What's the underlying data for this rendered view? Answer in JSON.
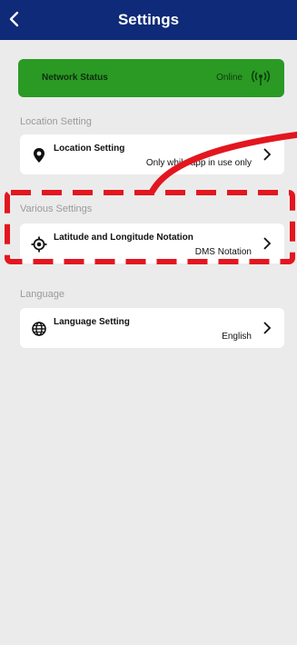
{
  "header": {
    "title": "Settings"
  },
  "network": {
    "label": "Network Status",
    "value": "Online"
  },
  "sections": {
    "location": "Location Setting",
    "various": "Various Settings",
    "language": "Language"
  },
  "items": {
    "location": {
      "label": "Location Setting",
      "value": "Only while app in use only"
    },
    "latlon": {
      "label": "Latitude and Longitude Notation",
      "value": "DMS Notation"
    },
    "language": {
      "label": "Language Setting",
      "value": "English"
    }
  },
  "icons": {
    "back": "chevron-left-icon",
    "network": "antenna-icon",
    "location": "map-pin-icon",
    "latlon": "crosshair-icon",
    "language": "globe-icon",
    "chevron": "chevron-right-icon"
  },
  "colors": {
    "header": "#0e2a78",
    "network_bg": "#2a9a24",
    "page_bg": "#ebebeb",
    "annotation": "#e3161f"
  }
}
